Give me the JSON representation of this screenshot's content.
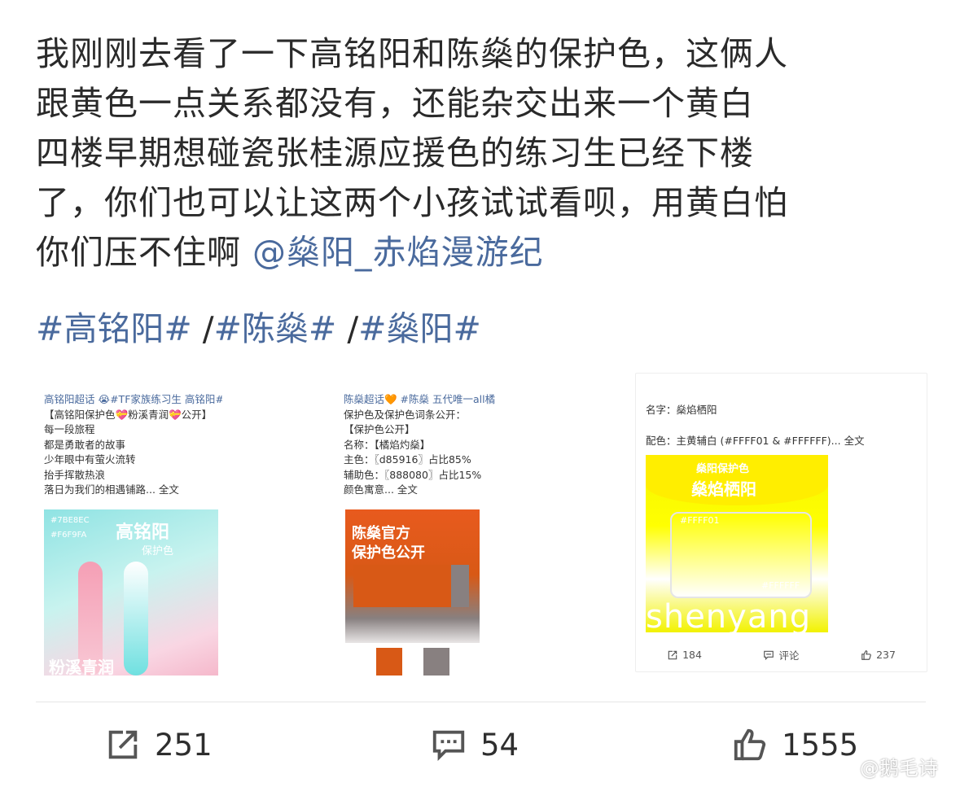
{
  "post": {
    "lines": [
      "我刚刚去看了一下高铭阳和陈燊的保护色，这俩人",
      "跟黄色一点关系都没有，还能杂交出来一个黄白",
      "四楼早期想碰瓷张桂源应援色的练习生已经下楼",
      "了，你们也可以让这两个小孩试试看呗，用黄白怕"
    ],
    "last_line_prefix": "你们压不住啊 ",
    "mention": "@燊阳_赤焰漫游纪",
    "hashtags": [
      "#高铭阳#",
      "#陈燊#",
      "#燊阳#"
    ],
    "hashtag_separator": " /"
  },
  "cards": {
    "card1": {
      "lines": [
        "高铭阳超话 😭#TF家族练习生 高铭阳#",
        "【高铭阳保护色💝粉溪青润💝公开】",
        "每一段旅程",
        "都是勇敢者的故事",
        "少年眼中有萤火流转",
        "抬手挥散热浪",
        "落日为我们的相遇铺路... 全文"
      ],
      "img_title": "高铭阳",
      "img_sub": "保护色",
      "img_code1": "#7BE8EC",
      "img_code2": "#F6F9FA",
      "img_bottom": "粉溪青润"
    },
    "card2": {
      "lines": [
        "陈燊超话🧡 #陈燊 五代唯一all橘all灰#",
        "保护色及保护色词条公开：",
        "【保护色公开】",
        "名称：【橘焰灼燊】",
        "主色：〖d85916〗占比85%",
        "辅助色：〖888080〗占比15%",
        "颜色寓意... 全文"
      ],
      "img_head1": "陈燊官方",
      "img_head2": "保护色公开"
    },
    "card3": {
      "name_line": "名字：燊焰栖阳",
      "color_line": "配色：主黄辅白 (#FFFF01 & #FFFFFF)... 全文",
      "img_h1": "燊阳保护色",
      "img_h2": "燊焰栖阳",
      "img_code1": "#FFFF01",
      "img_code2": "#FFFFFF",
      "img_big": "shenyang",
      "repost": "184",
      "comment": "评论",
      "like": "237"
    }
  },
  "actions": {
    "repost_count": "251",
    "comment_count": "54",
    "like_count": "1555"
  },
  "watermark": "@鹅毛诗",
  "colors": {
    "link": "#4a6a9d",
    "orange": "#d85916",
    "gray": "#888080",
    "yellow": "#FFFF01"
  }
}
